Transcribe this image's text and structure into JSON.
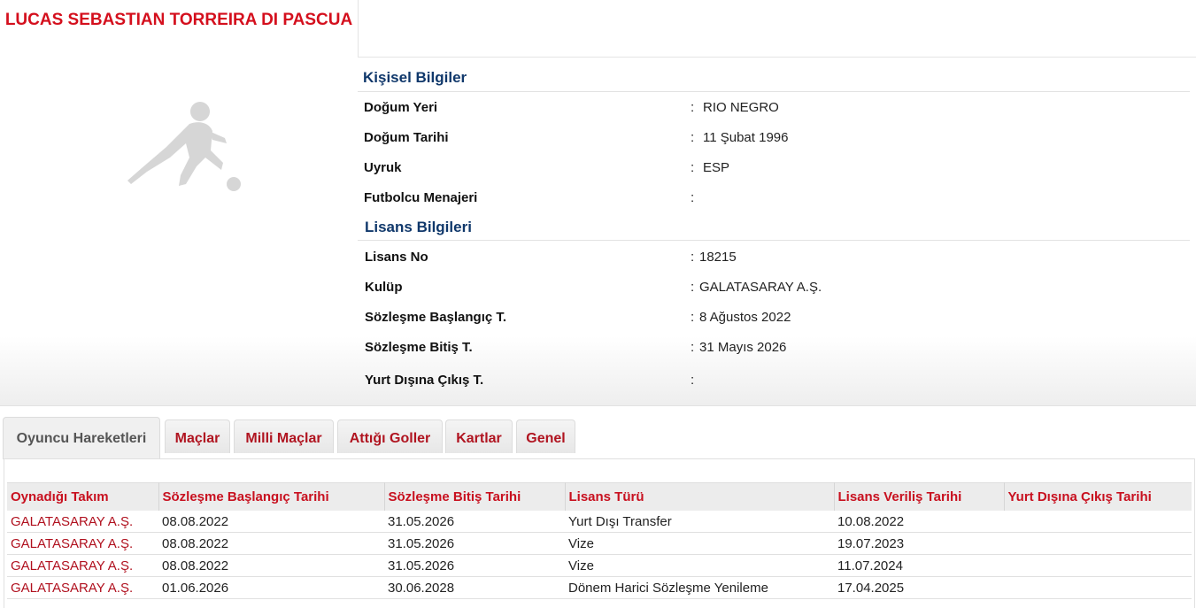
{
  "player": {
    "name": "LUCAS SEBASTIAN TORREIRA DI PASCUA"
  },
  "personal": {
    "title": "Kişisel Bilgiler",
    "rows": [
      {
        "label": "Doğum Yeri",
        "value": "RIO NEGRO"
      },
      {
        "label": "Doğum Tarihi",
        "value": "11 Şubat 1996"
      },
      {
        "label": "Uyruk",
        "value": "ESP"
      },
      {
        "label": "Futbolcu Menajeri",
        "value": ""
      }
    ]
  },
  "license": {
    "title": "Lisans Bilgileri",
    "rows": [
      {
        "label": "Lisans No",
        "value": "18215"
      },
      {
        "label": "Kulüp",
        "value": "GALATASARAY A.Ş."
      },
      {
        "label": "Sözleşme Başlangıç T.",
        "value": "8 Ağustos 2022"
      },
      {
        "label": "Sözleşme Bitiş T.",
        "value": "31 Mayıs 2026"
      },
      {
        "label": "Yurt Dışına Çıkış T.",
        "value": ""
      }
    ]
  },
  "colon": ":",
  "tabs": [
    {
      "label": "Oyuncu Hareketleri",
      "active": true
    },
    {
      "label": "Maçlar"
    },
    {
      "label": "Milli Maçlar"
    },
    {
      "label": "Attığı Goller"
    },
    {
      "label": "Kartlar"
    },
    {
      "label": "Genel"
    }
  ],
  "moves": {
    "columns": [
      "Oynadığı Takım",
      "Sözleşme Başlangıç Tarihi",
      "Sözleşme Bitiş Tarihi",
      "Lisans Türü",
      "Lisans Veriliş Tarihi",
      "Yurt Dışına Çıkış Tarihi"
    ],
    "rows": [
      [
        "GALATASARAY A.Ş.",
        "08.08.2022",
        "31.05.2026",
        "Yurt Dışı Transfer",
        "10.08.2022",
        ""
      ],
      [
        "GALATASARAY A.Ş.",
        "08.08.2022",
        "31.05.2026",
        "Vize",
        "19.07.2023",
        ""
      ],
      [
        "GALATASARAY A.Ş.",
        "08.08.2022",
        "31.05.2026",
        "Vize",
        "11.07.2024",
        ""
      ],
      [
        "GALATASARAY A.Ş.",
        "01.06.2026",
        "30.06.2028",
        "Dönem Harici Sözleşme Yenileme",
        "17.04.2025",
        ""
      ]
    ]
  },
  "colors": {
    "accent_red": "#d40f1d",
    "section_blue": "#10386b",
    "link_red": "#b0101e"
  },
  "icons": {
    "photo_placeholder": "player-silhouette-icon"
  }
}
